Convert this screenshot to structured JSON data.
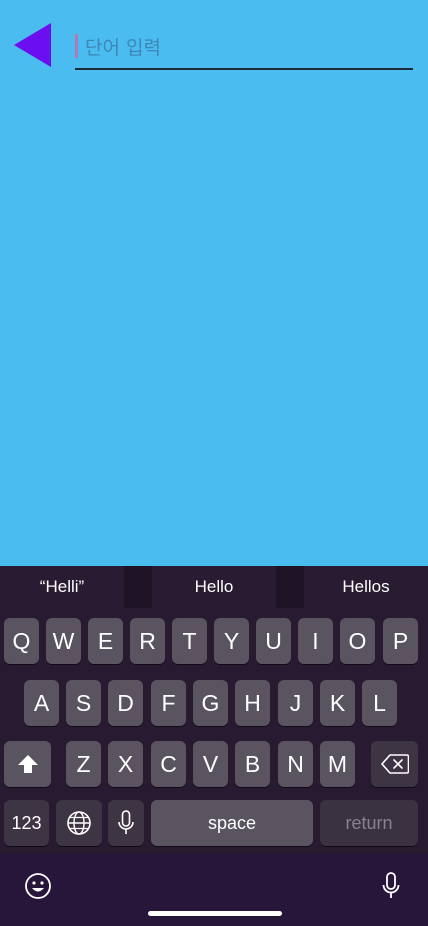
{
  "search": {
    "placeholder": "단어 입력",
    "value": ""
  },
  "icons": {
    "back": "back-arrow-icon",
    "globe": "globe-icon",
    "mic": "microphone-icon",
    "emoji": "emoji-icon",
    "shift": "shift-icon",
    "delete": "backspace-icon"
  },
  "colors": {
    "background": "#4bbcf0",
    "back_arrow": "#6b0ef0",
    "keyboard": "#281a31",
    "key": "#5a5360",
    "key_dark": "#3d3544"
  },
  "keyboard": {
    "suggestions": [
      "“Helli”",
      "Hello",
      "Hellos"
    ],
    "row1": [
      "Q",
      "W",
      "E",
      "R",
      "T",
      "Y",
      "U",
      "I",
      "O",
      "P"
    ],
    "row2": [
      "A",
      "S",
      "D",
      "F",
      "G",
      "H",
      "J",
      "K",
      "L"
    ],
    "row3": [
      "Z",
      "X",
      "C",
      "V",
      "B",
      "N",
      "M"
    ],
    "numbers_label": "123",
    "space_label": "space",
    "return_label": "return"
  }
}
